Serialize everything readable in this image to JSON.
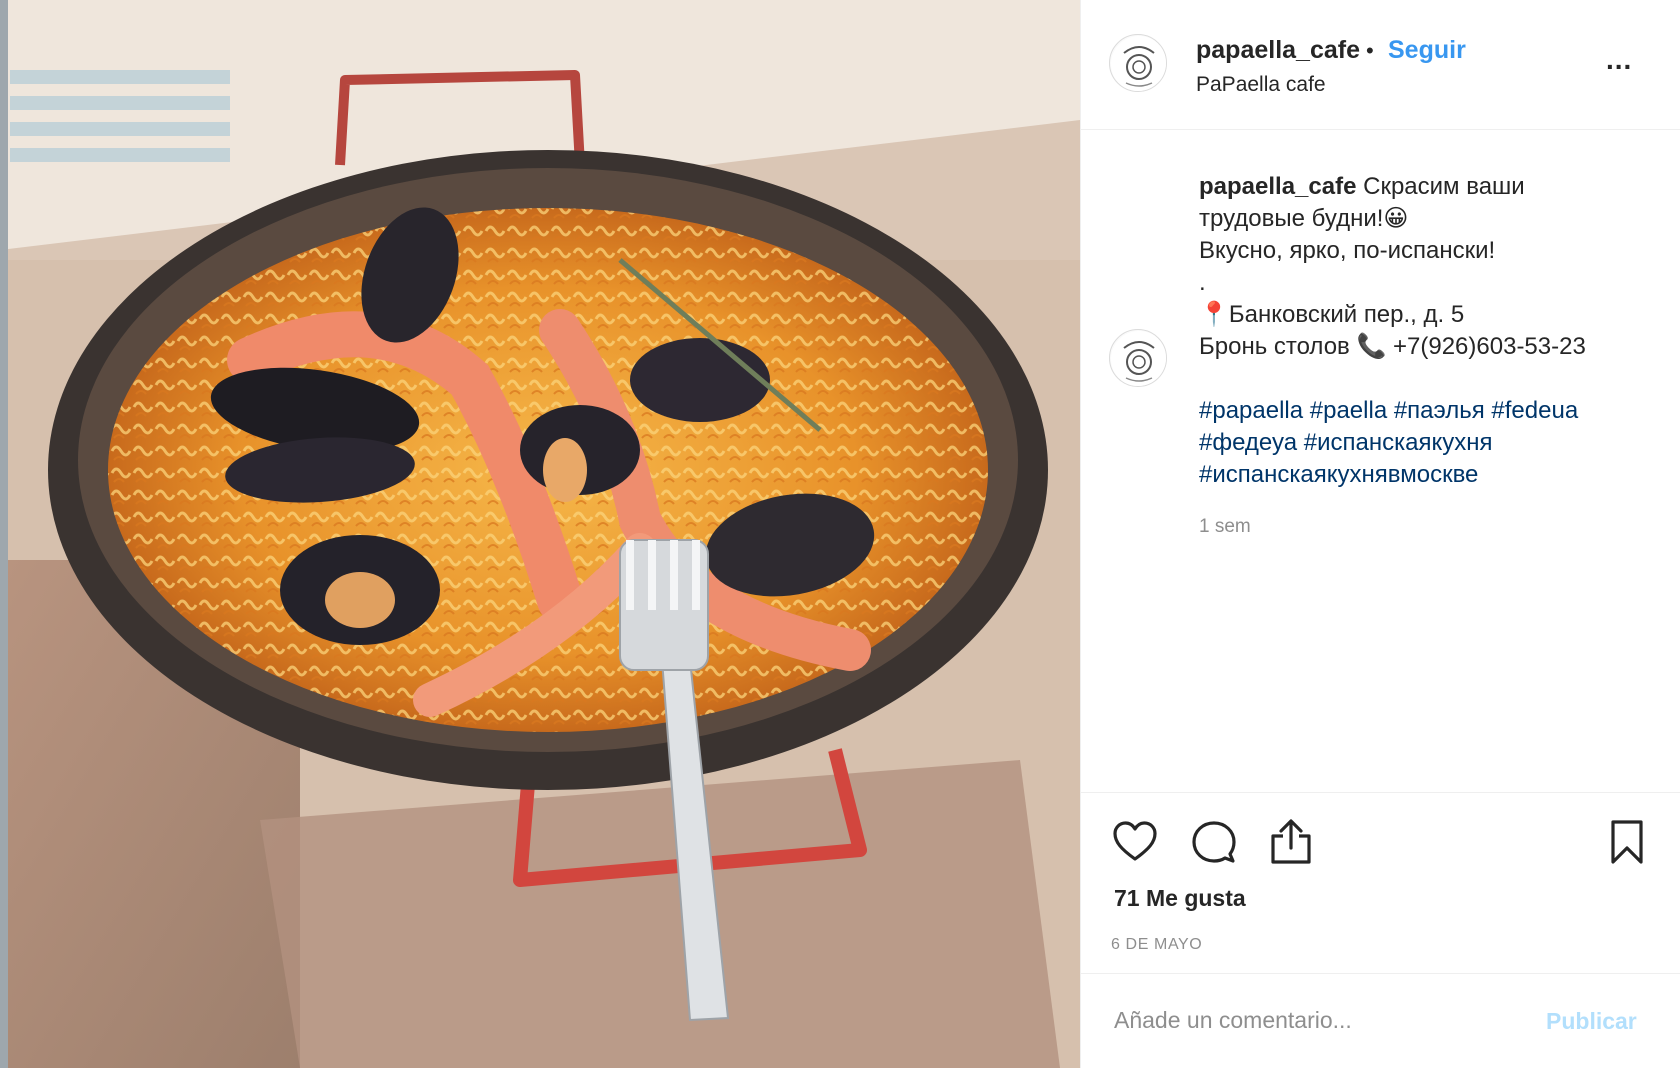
{
  "post": {
    "image_icon": "paella-photo",
    "image_alt": "Paella con mariscos"
  },
  "header": {
    "username": "papaella_cafe",
    "separator": "•",
    "follow_label": "Seguir",
    "subtitle": "PaPaella cafe",
    "more_icon": "more-options-icon",
    "more_glyph": "..."
  },
  "caption": {
    "username": "papaella_cafe",
    "line1": "Скрасим ваши",
    "line2": "трудовые будни!😀",
    "line3": "Вкусно, ярко, по-испански!",
    "line4": ".",
    "line5": "📍Банковский пер., д. 5",
    "line6": "Бронь столов 📞 +7(926)603-53-23",
    "tags": [
      "#papaella #paella #паэлья #fedeua",
      "#федеуа #испанскаякухня",
      "#испанскаякухнявмоскве"
    ],
    "time_ago": "1 sem"
  },
  "actions": {
    "like_icon": "heart-icon",
    "comment_icon": "comment-icon",
    "share_icon": "share-icon",
    "save_icon": "bookmark-icon",
    "likes": "71 Me gusta",
    "date": "6 DE MAYO"
  },
  "comment": {
    "placeholder": "Añade un comentario...",
    "publish_label": "Publicar"
  },
  "colors": {
    "accent": "#3897f0",
    "hashtag": "#003569",
    "muted": "#8e8e8e",
    "publish_disabled": "#b2dffc"
  }
}
